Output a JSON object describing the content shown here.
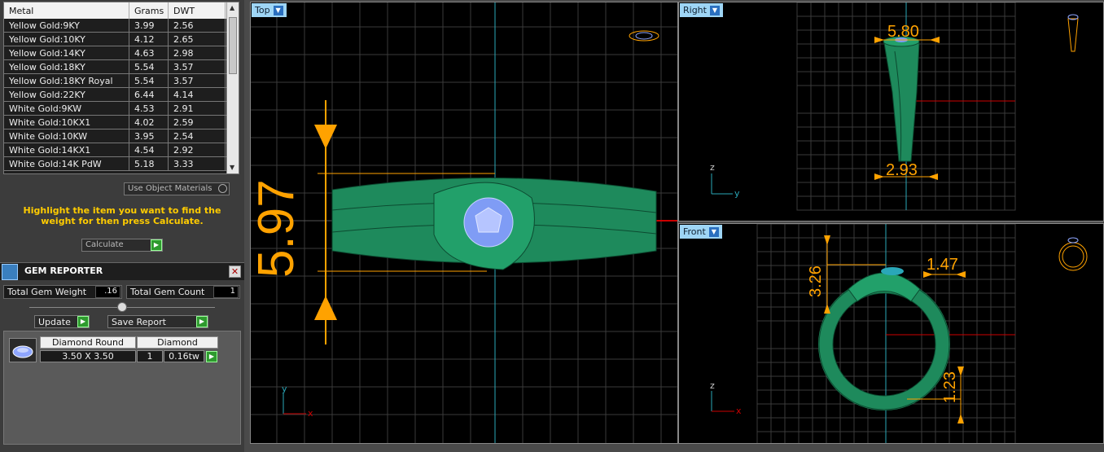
{
  "metal_table": {
    "headers": [
      "Metal",
      "Grams",
      "DWT"
    ],
    "rows": [
      [
        "Yellow Gold:9KY",
        "3.99",
        "2.56"
      ],
      [
        "Yellow Gold:10KY",
        "4.12",
        "2.65"
      ],
      [
        "Yellow Gold:14KY",
        "4.63",
        "2.98"
      ],
      [
        "Yellow Gold:18KY",
        "5.54",
        "3.57"
      ],
      [
        "Yellow Gold:18KY Royal",
        "5.54",
        "3.57"
      ],
      [
        "Yellow Gold:22KY",
        "6.44",
        "4.14"
      ],
      [
        "White Gold:9KW",
        "4.53",
        "2.91"
      ],
      [
        "White Gold:10KX1",
        "4.02",
        "2.59"
      ],
      [
        "White Gold:10KW",
        "3.95",
        "2.54"
      ],
      [
        "White Gold:14KX1",
        "4.54",
        "2.92"
      ],
      [
        "White Gold:14K PdW",
        "5.18",
        "3.33"
      ]
    ]
  },
  "use_object_materials": "Use Object Materials",
  "hint": "Highlight the item you want to find the weight for then press Calculate.",
  "calculate": "Calculate",
  "gem_reporter": {
    "title": "GEM REPORTER",
    "total_weight_label": "Total Gem Weight",
    "total_weight": ".16",
    "total_count_label": "Total Gem Count",
    "total_count": "1",
    "update": "Update",
    "save_report": "Save Report",
    "gem": {
      "shape": "Diamond Round",
      "material": "Diamond",
      "size": "3.50 X 3.50",
      "count": "1",
      "weight": "0.16tw"
    }
  },
  "viewports": {
    "top": {
      "label": "Top",
      "dimension": "5.97",
      "axis1": "y",
      "axis2": "x"
    },
    "right": {
      "label": "Right",
      "dim_top": "5.80",
      "dim_bottom": "2.93",
      "axis1": "z",
      "axis2": "y"
    },
    "front": {
      "label": "Front",
      "dim_left": "3.26",
      "dim_right": "1.47",
      "dim_bottom": "1.23",
      "axis1": "z",
      "axis2": "x"
    }
  },
  "colors": {
    "ring": "#1e8a5c",
    "dimension": "#ffa200",
    "grid": "#3a3a3a",
    "viewport_label": "#9ed5f5",
    "gem": "#7f9cf5"
  }
}
